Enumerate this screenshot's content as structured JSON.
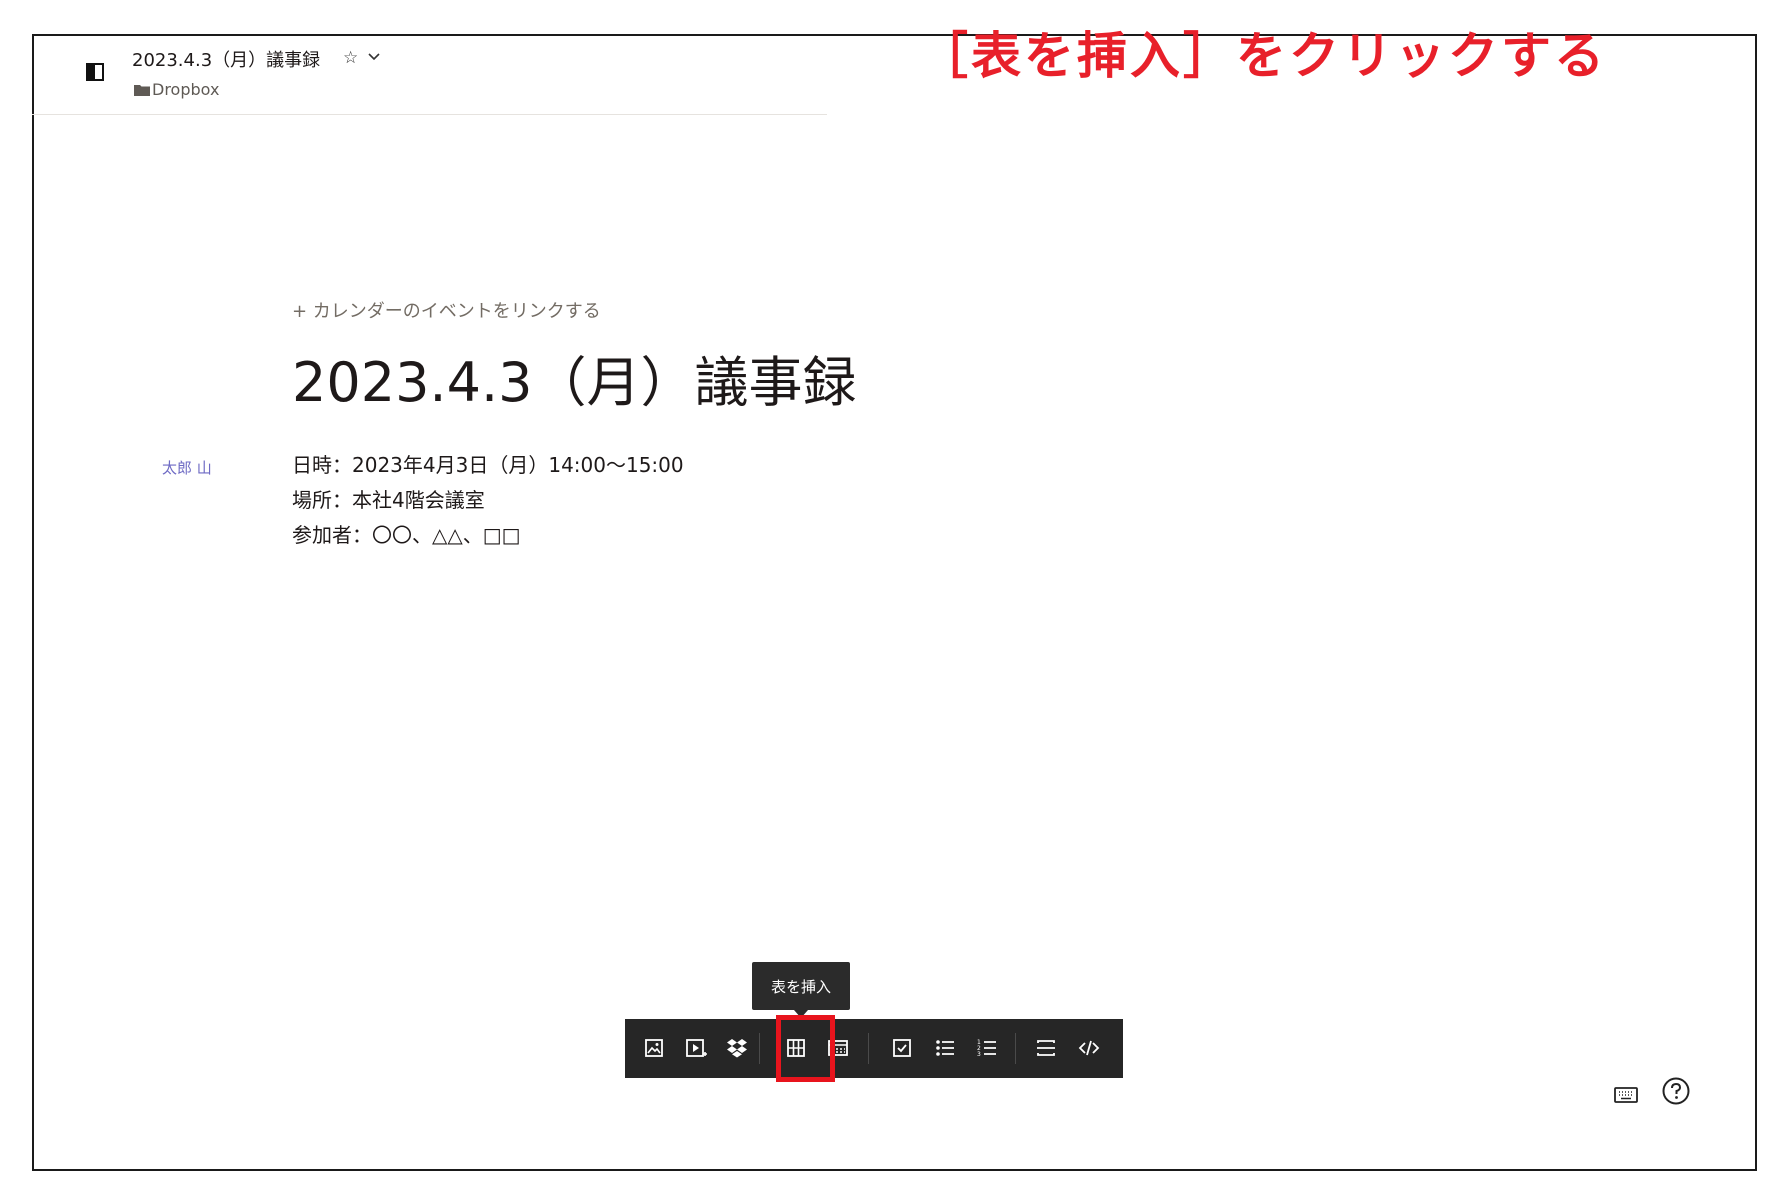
{
  "header": {
    "doc_title": "2023.4.3（月）議事録",
    "folder": "Dropbox"
  },
  "annotation": "［表を挿入］をクリックする",
  "document": {
    "calendar_link": "+ カレンダーのイベントをリンクする",
    "title": "2023.4.3（月）議事録",
    "author": "太郎 山",
    "lines": [
      "日時：2023年4月3日（月）14:00～15:00",
      "場所：本社4階会議室",
      "参加者：〇〇、△△、□□"
    ]
  },
  "tooltip": "表を挿入",
  "toolbar": {
    "buttons": [
      {
        "name": "insert-image-icon"
      },
      {
        "name": "insert-media-icon"
      },
      {
        "name": "dropbox-icon"
      },
      {
        "name": "insert-table-icon"
      },
      {
        "name": "insert-timeline-icon"
      },
      {
        "name": "checklist-icon"
      },
      {
        "name": "bullet-list-icon"
      },
      {
        "name": "numbered-list-icon"
      },
      {
        "name": "divider-icon"
      },
      {
        "name": "code-icon"
      }
    ]
  },
  "colors": {
    "annotation": "#e8202a",
    "highlight": "#e8141d",
    "toolbar_bg": "#262626",
    "author": "#6e6ac4"
  }
}
